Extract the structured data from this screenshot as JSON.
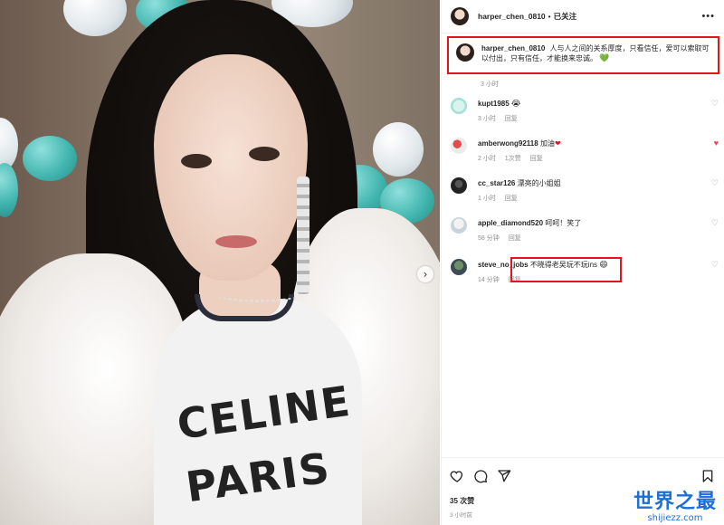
{
  "header": {
    "username": "harper_chen_0810",
    "separator": "•",
    "follow_state": "已关注",
    "more_icon": "more-dots-icon"
  },
  "caption": {
    "username": "harper_chen_0810",
    "text": "人与人之间的关系厚度，只看信任，爱可以索取可以付出，只有信任，才能换来忠诚。",
    "emoji": "💚",
    "time": "3 小时"
  },
  "comments": [
    {
      "username": "kupt1985",
      "text": "",
      "emoji": "😭",
      "time": "3 小时",
      "reply": "回复",
      "likes": "",
      "liked": false
    },
    {
      "username": "amberwong92118",
      "text": "加油",
      "emoji": "❤",
      "time": "2 小时",
      "likes": "1次赞",
      "reply": "回复",
      "liked": true
    },
    {
      "username": "cc_star126",
      "text": "漂亮的小姐姐",
      "emoji": "",
      "time": "1 小时",
      "reply": "回复",
      "likes": "",
      "liked": false
    },
    {
      "username": "apple_diamond520",
      "text": "呵呵！笑了",
      "emoji": "",
      "time": "58 分钟",
      "reply": "回复",
      "likes": "",
      "liked": false
    },
    {
      "username": "steve_no_jobs",
      "text": "不晓得老吴玩不玩ins",
      "emoji": "😄",
      "time": "14 分钟",
      "reply": "回复",
      "likes": "",
      "liked": false
    }
  ],
  "post": {
    "likes": "35 次赞",
    "time": "3 小时前"
  },
  "watermark": {
    "title": "世界之最",
    "site": "shijiezz.com"
  },
  "colors": {
    "highlight": "#e0161c",
    "like_red": "#ed4956",
    "watermark_blue": "#1c6fd6"
  }
}
